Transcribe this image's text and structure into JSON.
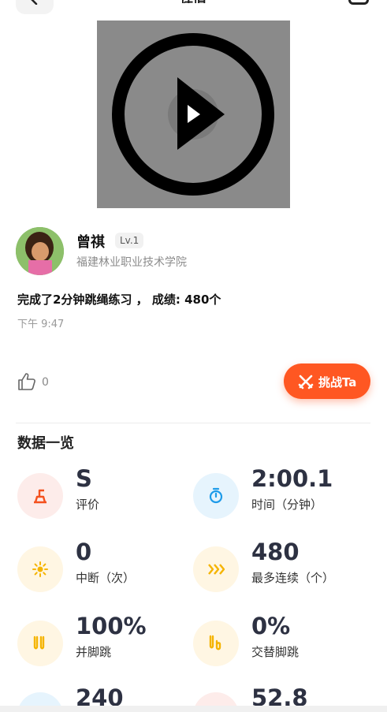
{
  "header": {
    "title": "详情"
  },
  "user": {
    "name": "曾祺",
    "level": "Lv.1",
    "school": "福建林业职业技术学院"
  },
  "post": {
    "summary": "完成了2分钟跳绳练习 ， 成绩: 480个",
    "time": "下午 9:47"
  },
  "actions": {
    "like_count": "0",
    "challenge_label": "挑战Ta"
  },
  "stats_section": {
    "title": "数据一览",
    "items": [
      {
        "value": "S",
        "label": "评价",
        "icon": "rating-icon",
        "color": "#f4511e",
        "bg": "#fdecea"
      },
      {
        "value": "2:00.1",
        "label": "时间（分钟）",
        "icon": "stopwatch-icon",
        "color": "#1e9be9",
        "bg": "#e6f4fd"
      },
      {
        "value": "0",
        "label": "中断（次）",
        "icon": "sun-icon",
        "color": "#f5b400",
        "bg": "#fff6e3"
      },
      {
        "value": "480",
        "label": "最多连续（个）",
        "icon": "chevrons-right-icon",
        "color": "#f5b400",
        "bg": "#fff6e3"
      },
      {
        "value": "100%",
        "label": "并脚跳",
        "icon": "both-feet-icon",
        "color": "#f5b400",
        "bg": "#fff6e3"
      },
      {
        "value": "0%",
        "label": "交替脚跳",
        "icon": "alternate-feet-icon",
        "color": "#f5b400",
        "bg": "#fff6e3"
      },
      {
        "value": "240",
        "label": "",
        "icon": "speed-icon",
        "color": "#1e9be9",
        "bg": "#e6f4fd"
      },
      {
        "value": "52.8",
        "label": "",
        "icon": "calorie-icon",
        "color": "#f4511e",
        "bg": "#fdecea"
      }
    ]
  }
}
